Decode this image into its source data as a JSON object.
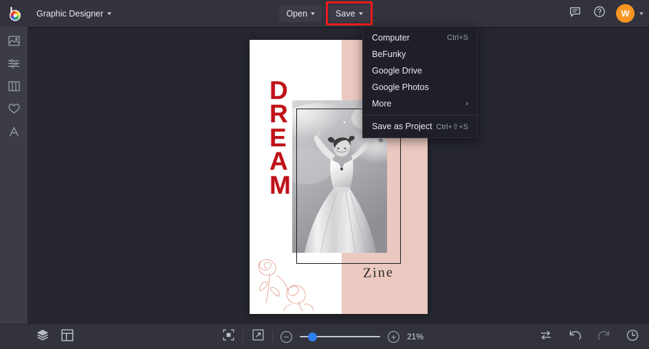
{
  "app": {
    "name": "BeFunky Graphic Designer",
    "logo_icon": "befunky-logo-icon"
  },
  "topbar": {
    "document_title": "Graphic Designer",
    "open_label": "Open",
    "save_label": "Save",
    "save_highlight_color": "#ed1c1c",
    "icons": {
      "feedback": "speech-bubble-icon",
      "help": "question-mark-circle-icon",
      "account_caret": "chevron-down-icon"
    },
    "avatar_initial": "W",
    "avatar_color": "#f79521"
  },
  "save_menu": {
    "open": true,
    "items": [
      {
        "label": "Computer",
        "shortcut": "Ctrl+S",
        "submenu": false
      },
      {
        "label": "BeFunky",
        "shortcut": "",
        "submenu": false
      },
      {
        "label": "Google Drive",
        "shortcut": "",
        "submenu": false
      },
      {
        "label": "Google Photos",
        "shortcut": "",
        "submenu": false
      },
      {
        "label": "More",
        "shortcut": "",
        "submenu": true,
        "arrow": "›"
      },
      {
        "label": "Save as Project",
        "shortcut": "Ctrl+⇧+S",
        "submenu": false
      }
    ]
  },
  "sidebar": {
    "items": [
      {
        "name": "image-manager",
        "icon": "image-icon"
      },
      {
        "name": "edit-adjust",
        "icon": "sliders-icon"
      },
      {
        "name": "templates",
        "icon": "columns-icon"
      },
      {
        "name": "graphics",
        "icon": "heart-icon"
      },
      {
        "name": "text-tool",
        "icon": "text-a-icon"
      }
    ]
  },
  "canvas": {
    "background": "#ffffff",
    "pink_band_color": "#ebc9c0",
    "headline_letters": [
      "D",
      "R",
      "E",
      "A",
      "M"
    ],
    "headline_color": "#c01118",
    "vertical_text": "Volume",
    "script_text": "Zine",
    "photo_alt": "grayscale photo of woman in white dress",
    "rose_line_art_color": "#e2a393"
  },
  "bottombar": {
    "layers_icon": "layers-icon",
    "canvas_icon": "canvas-layout-icon",
    "fit_icon": "fit-to-screen-icon",
    "expand_icon": "fullscreen-expand-icon",
    "zoom_out_label": "−",
    "zoom_in_label": "+",
    "zoom_value": "21%",
    "zoom_slider_percent": 12,
    "replace_icon": "swap-replace-icon",
    "undo_icon": "undo-arrow-icon",
    "redo_icon": "redo-arrow-icon",
    "history_icon": "history-clock-icon"
  }
}
